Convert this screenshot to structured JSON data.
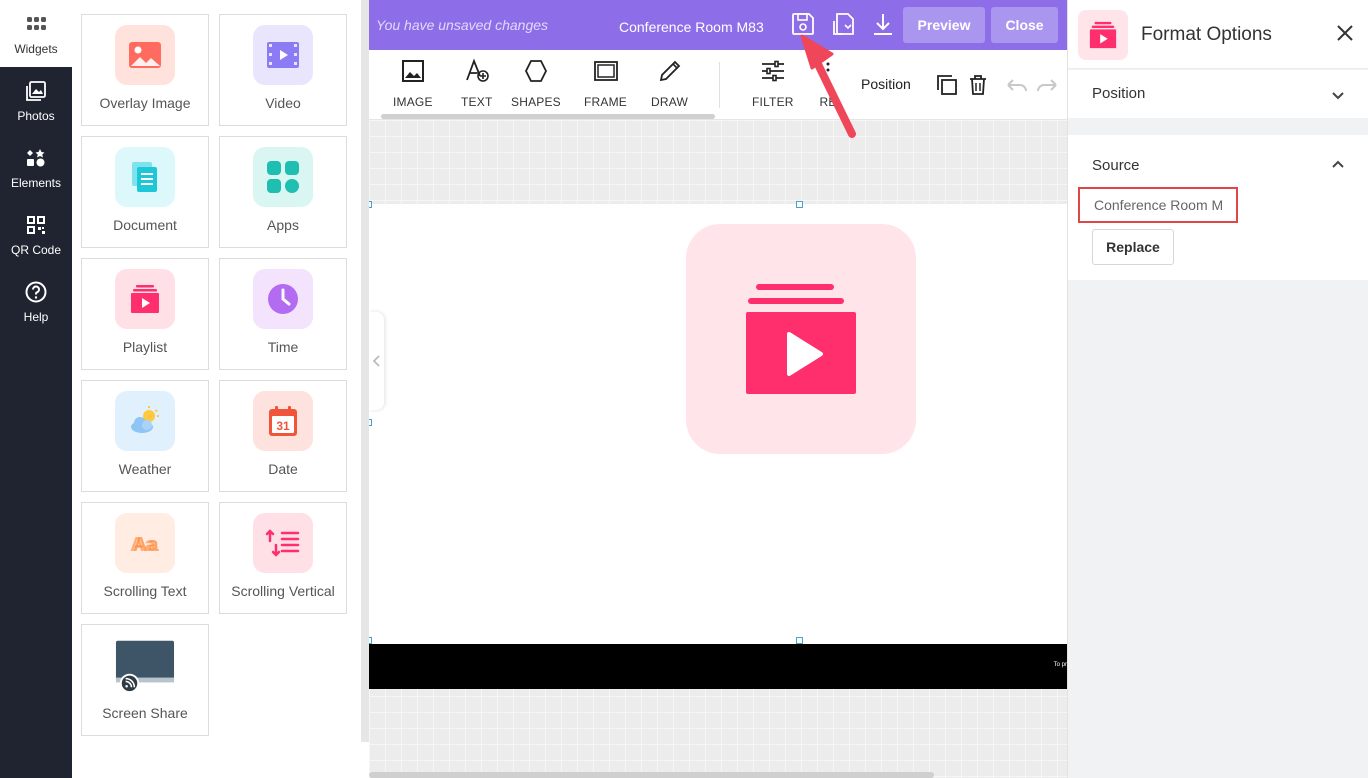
{
  "rail": {
    "items": [
      {
        "label": "Widgets",
        "icon": "grid-dots-icon"
      },
      {
        "label": "Photos",
        "icon": "photos-icon"
      },
      {
        "label": "Elements",
        "icon": "elements-icon"
      },
      {
        "label": "QR Code",
        "icon": "qr-code-icon"
      },
      {
        "label": "Help",
        "icon": "help-icon"
      }
    ]
  },
  "widgets": {
    "tiles": [
      {
        "label": "Overlay Image",
        "icon": "image-icon",
        "color": "#ff6b5e"
      },
      {
        "label": "Video",
        "icon": "video-icon",
        "color": "#8b7cf5"
      },
      {
        "label": "Document",
        "icon": "document-icon",
        "color": "#1cc8d8"
      },
      {
        "label": "Apps",
        "icon": "apps-icon",
        "color": "#1ebfb1"
      },
      {
        "label": "Playlist",
        "icon": "playlist-icon",
        "color": "#ff2f6d"
      },
      {
        "label": "Time",
        "icon": "clock-icon",
        "color": "#b36bf2"
      },
      {
        "label": "Weather",
        "icon": "weather-icon",
        "color": "#5aa8f0"
      },
      {
        "label": "Date",
        "icon": "calendar-icon",
        "color": "#f0553c"
      },
      {
        "label": "Scrolling Text",
        "icon": "scrolling-text-icon",
        "color": "#ff8a3d"
      },
      {
        "label": "Scrolling Vertical",
        "icon": "scrolling-vertical-icon",
        "color": "#ff2f6d"
      },
      {
        "label": "Screen Share",
        "icon": "screen-share-icon",
        "color": "#3d5566"
      }
    ]
  },
  "header": {
    "unsaved": "You have unsaved changes",
    "title": "Conference Room M83",
    "preview_label": "Preview",
    "close_label": "Close",
    "bg_color": "#8d6ee8"
  },
  "toolbar": {
    "tools": [
      {
        "label": "IMAGE",
        "icon": "image-icon"
      },
      {
        "label": "TEXT",
        "icon": "text-add-icon"
      },
      {
        "label": "SHAPES",
        "icon": "shapes-icon"
      },
      {
        "label": "FRAME",
        "icon": "frame-icon"
      },
      {
        "label": "DRAW",
        "icon": "pencil-icon"
      },
      {
        "label": "FILTER",
        "icon": "filter-sliders-icon"
      },
      {
        "label": "RE",
        "icon": "more-icon"
      }
    ],
    "position_label": "Position"
  },
  "canvas": {
    "footer_text": "To pr"
  },
  "format_panel": {
    "title": "Format Options",
    "position_title": "Position",
    "source_title": "Source",
    "source_value": "Conference Room M",
    "replace_label": "Replace"
  }
}
